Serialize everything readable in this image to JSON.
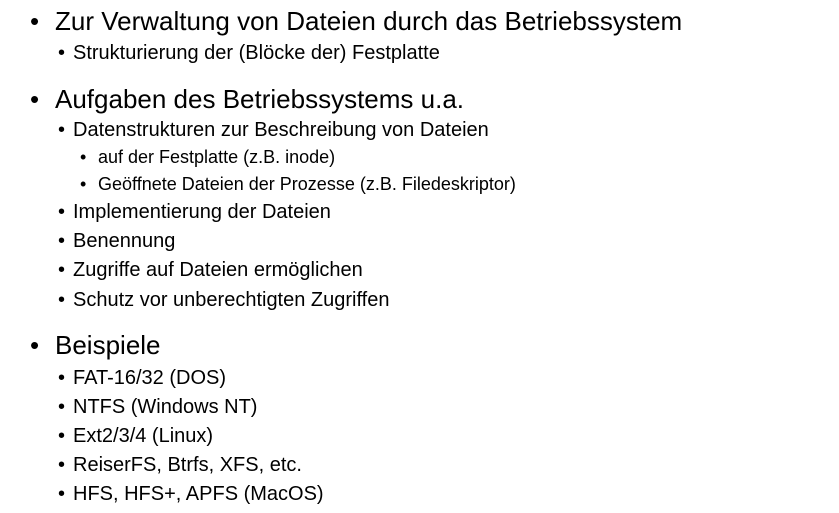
{
  "slide": {
    "sections": [
      {
        "heading": "Zur Verwaltung von Dateien durch das Betriebssystem",
        "items": [
          {
            "text": "Strukturierung der (Blöcke der) Festplatte"
          }
        ]
      },
      {
        "heading": "Aufgaben des Betriebssystems u.a.",
        "items": [
          {
            "text": "Datenstrukturen zur Beschreibung von Dateien"
          },
          {
            "text": "auf der Festplatte (z.B. inode)"
          },
          {
            "text": "Geöffnete Dateien der Prozesse (z.B. Filedeskriptor)"
          },
          {
            "text": "Implementierung der Dateien"
          },
          {
            "text": "Benennung"
          },
          {
            "text": "Zugriffe auf Dateien ermöglichen"
          },
          {
            "text": "Schutz vor unberechtigten Zugriffen"
          }
        ]
      },
      {
        "heading": "Beispiele",
        "items": [
          {
            "text": "FAT-16/32 (DOS)"
          },
          {
            "text": "NTFS (Windows NT)"
          },
          {
            "text": "Ext2/3/4 (Linux)"
          },
          {
            "text": "ReiserFS, Btrfs, XFS, etc."
          },
          {
            "text": "HFS, HFS+, APFS (MacOS)"
          }
        ]
      }
    ]
  }
}
